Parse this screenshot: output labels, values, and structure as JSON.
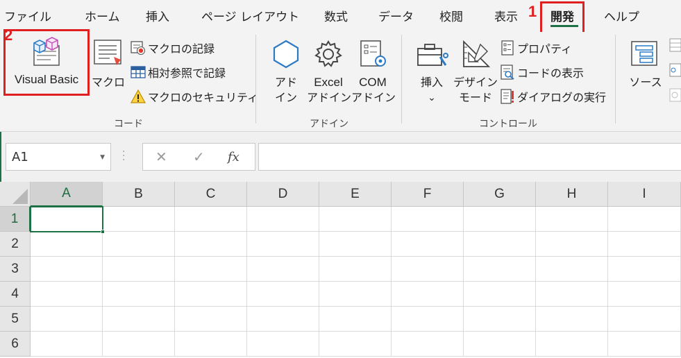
{
  "tabs": [
    {
      "label": "ファイル"
    },
    {
      "label": "ホーム"
    },
    {
      "label": "挿入"
    },
    {
      "label": "ページ レイアウト"
    },
    {
      "label": "数式"
    },
    {
      "label": "データ"
    },
    {
      "label": "校閲"
    },
    {
      "label": "表示"
    },
    {
      "label": "開発",
      "active": true
    },
    {
      "label": "ヘルプ"
    }
  ],
  "annotations": {
    "step1": "1",
    "step2": "2"
  },
  "groups": {
    "code": {
      "label": "コード",
      "visual_basic": "Visual Basic",
      "macro": "マクロ",
      "record_macro": "マクロの記録",
      "relative_ref": "相対参照で記録",
      "macro_security": "マクロのセキュリティ"
    },
    "addins": {
      "label": "アドイン",
      "addin_line1": "アド",
      "addin_line2": "イン",
      "excel_addin_line1": "Excel",
      "excel_addin_line2": "アドイン",
      "com_addin_line1": "COM",
      "com_addin_line2": "アドイン"
    },
    "controls": {
      "label": "コントロール",
      "insert": "挿入",
      "insert_chevron": "⌄",
      "design_line1": "デザイン",
      "design_line2": "モード",
      "properties": "プロパティ",
      "view_code": "コードの表示",
      "run_dialog": "ダイアログの実行"
    },
    "xml": {
      "source": "ソース"
    }
  },
  "formula_bar": {
    "name_box": "A1",
    "cancel_icon": "✕",
    "enter_icon": "✓",
    "fx": "fx",
    "formula": ""
  },
  "grid": {
    "columns": [
      "A",
      "B",
      "C",
      "D",
      "E",
      "F",
      "G",
      "H",
      "I"
    ],
    "rows": [
      "1",
      "2",
      "3",
      "4",
      "5",
      "6"
    ],
    "selected_cell": "A1"
  },
  "colors": {
    "accent": "#1e7145",
    "highlight": "#e02020",
    "ribbon_bg": "#f3f3f3"
  }
}
